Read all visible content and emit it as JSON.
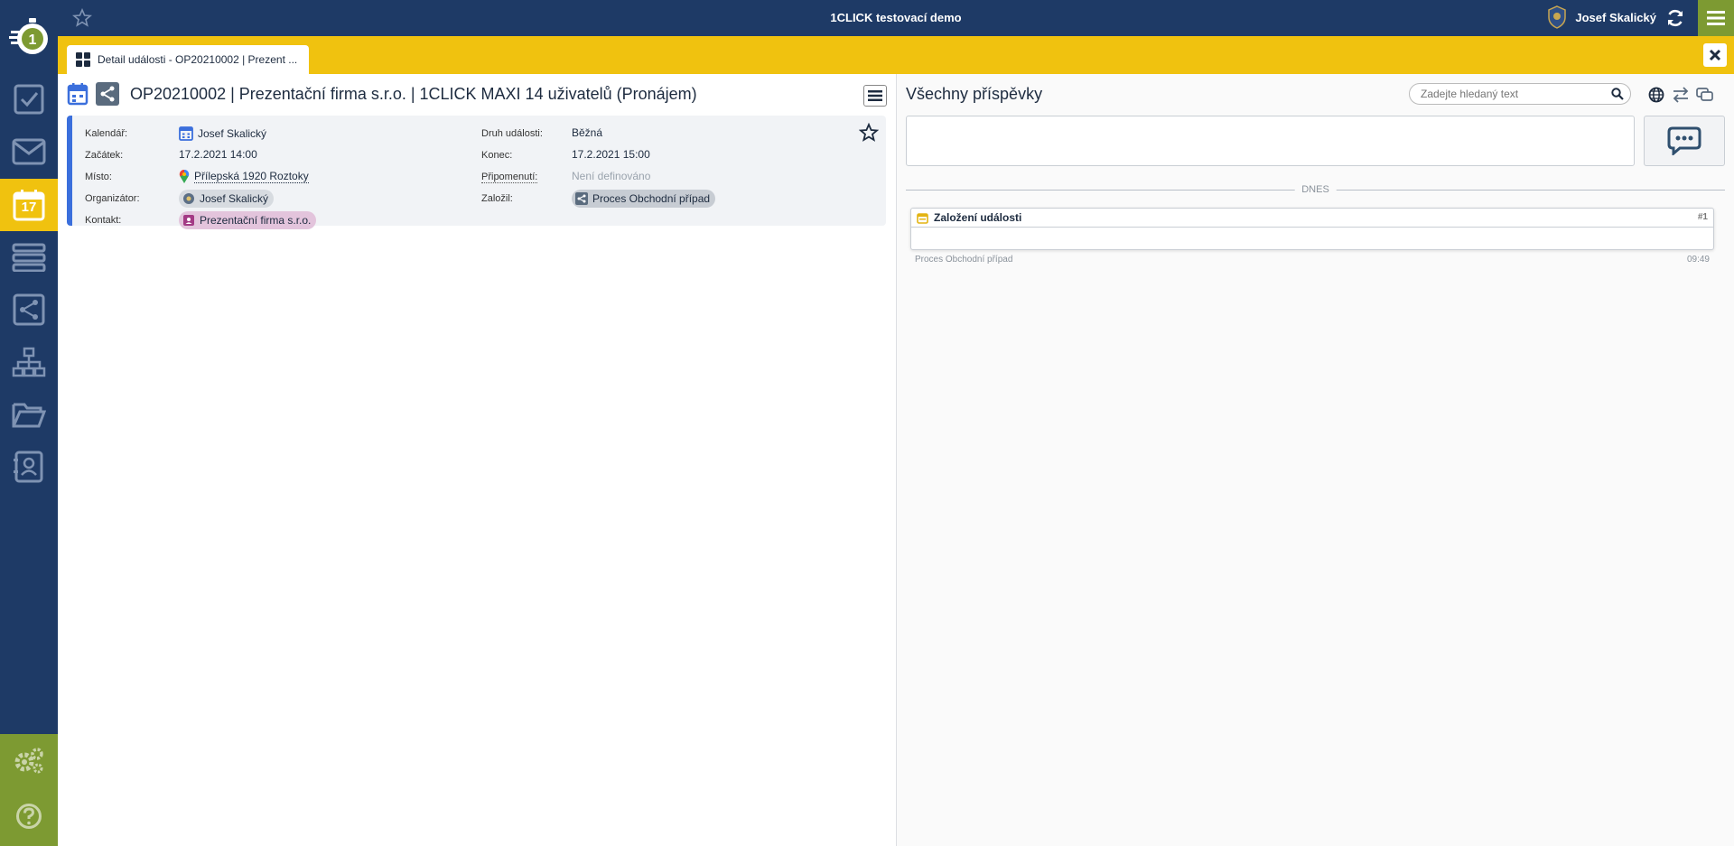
{
  "topbar": {
    "app_title": "1CLICK testovací demo",
    "user_name": "Josef Skalický"
  },
  "sidebar": {
    "items": [
      {
        "icon": "tasks-icon"
      },
      {
        "icon": "mail-icon"
      },
      {
        "icon": "calendar-icon",
        "badge": "17",
        "active": true
      },
      {
        "icon": "records-icon"
      },
      {
        "icon": "process-icon"
      },
      {
        "icon": "org-chart-icon"
      },
      {
        "icon": "folder-icon"
      },
      {
        "icon": "contacts-icon"
      }
    ],
    "bottom": [
      {
        "icon": "settings-icon"
      },
      {
        "icon": "help-icon"
      }
    ]
  },
  "tabs": [
    {
      "label": "Detail události - OP20210002 | Prezent ..."
    }
  ],
  "detail": {
    "title": "OP20210002 | Prezentační firma s.r.o. | 1CLICK MAXI 14 uživatelů (Pronájem)",
    "fields": {
      "kalendar_label": "Kalendář:",
      "kalendar_value": "Josef Skalický",
      "zacatek_label": "Začátek:",
      "zacatek_value": "17.2.2021 14:00",
      "misto_label": "Místo:",
      "misto_value": "Přílepská 1920 Roztoky",
      "organizator_label": "Organizátor:",
      "organizator_value": "Josef Skalický",
      "kontakt_label": "Kontakt:",
      "kontakt_value": "Prezentační firma s.r.o.",
      "druh_label": "Druh události:",
      "druh_value": "Běžná",
      "konec_label": "Konec:",
      "konec_value": "17.2.2021 15:00",
      "pripomenuti_label": "Připomenutí:",
      "pripomenuti_value": "Není definováno",
      "zalozil_label": "Založil:",
      "zalozil_value": "Proces Obchodní případ"
    }
  },
  "feed": {
    "title": "Všechny příspěvky",
    "search_placeholder": "Zadejte hledaný text",
    "day_label": "DNES",
    "posts": [
      {
        "title": "Založení události",
        "number": "#1",
        "author": "Proces Obchodní případ",
        "time": "09:49"
      }
    ]
  },
  "colors": {
    "navy": "#1e3a66",
    "yellow": "#f0c20f",
    "green": "#7d9a32",
    "blue_accent": "#3b6fdc"
  }
}
